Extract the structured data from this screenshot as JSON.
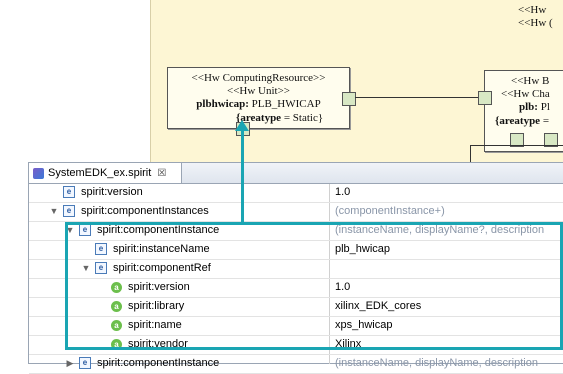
{
  "diagram": {
    "top_right": [
      "<<Hw",
      "<<Hw ("
    ],
    "left_box": {
      "line1": "<<Hw ComputingResource>>",
      "line2": "<<Hw Unit>>",
      "line3_bold": "plbhwicap:",
      "line3_rest": " PLB_HWICAP",
      "prop_bold": "{areatype",
      "prop_rest": " = Static}"
    },
    "right_box": {
      "line1": "<<Hw B",
      "line2": "<<Hw Cha",
      "line3_bold": "plb:",
      "line3_rest": " Pl",
      "prop_bold": "{areatype",
      "prop_rest": " ="
    }
  },
  "editor": {
    "tab_title": "SystemEDK_ex.spirit",
    "tab_close": "☒",
    "rows": [
      {
        "indent": 0,
        "twisty": "",
        "icon": "e",
        "name": "spirit:version",
        "value": "1.0",
        "grey": false
      },
      {
        "indent": 0,
        "twisty": "▼",
        "icon": "e",
        "name": "spirit:componentInstances",
        "value": "(componentInstance+)",
        "grey": true
      },
      {
        "indent": 1,
        "twisty": "▼",
        "icon": "e",
        "name": "spirit:componentInstance",
        "value": "(instanceName, displayName?, description",
        "grey": true
      },
      {
        "indent": 2,
        "twisty": "",
        "icon": "e",
        "name": "spirit:instanceName",
        "value": "plb_hwicap",
        "grey": false
      },
      {
        "indent": 2,
        "twisty": "▼",
        "icon": "e",
        "name": "spirit:componentRef",
        "value": "",
        "grey": false
      },
      {
        "indent": 3,
        "twisty": "",
        "icon": "a",
        "name": "spirit:version",
        "value": "1.0",
        "grey": false
      },
      {
        "indent": 3,
        "twisty": "",
        "icon": "a",
        "name": "spirit:library",
        "value": "xilinx_EDK_cores",
        "grey": false
      },
      {
        "indent": 3,
        "twisty": "",
        "icon": "a",
        "name": "spirit:name",
        "value": "xps_hwicap",
        "grey": false
      },
      {
        "indent": 3,
        "twisty": "",
        "icon": "a",
        "name": "spirit:vendor",
        "value": "Xilinx",
        "grey": false
      },
      {
        "indent": 1,
        "twisty": "▶",
        "icon": "e",
        "name": "spirit:componentInstance",
        "value": "(instanceName, displayName, description",
        "grey": true
      }
    ]
  },
  "colors": {
    "highlight": "#1aa5b3",
    "diagram_bg": "#fdf6d4"
  }
}
